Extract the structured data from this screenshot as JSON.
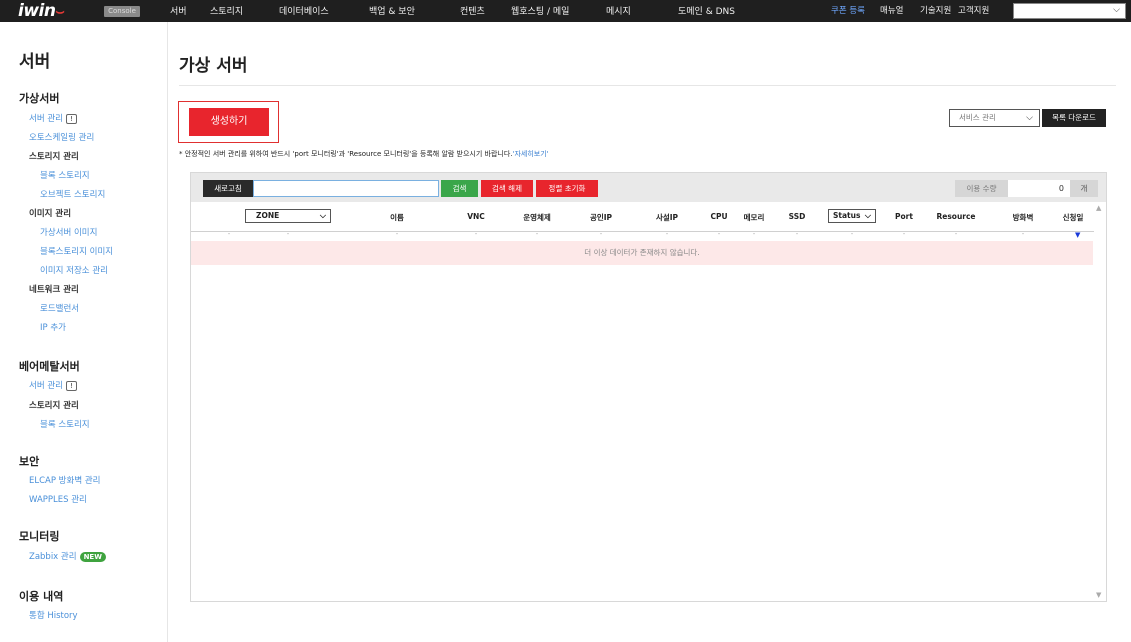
{
  "topbar": {
    "logo": "iwin",
    "console_badge": "Console",
    "nav": [
      "서버",
      "스토리지",
      "데이터베이스",
      "백업 & 보안",
      "컨텐츠",
      "웹호스팅 / 메일",
      "메시지",
      "도메인 & DNS"
    ],
    "right": {
      "coupon": "쿠폰 등록",
      "manual": "매뉴얼",
      "tech": "기술지원",
      "support": "고객지원"
    },
    "select_value": ""
  },
  "sidebar": {
    "title": "서버",
    "virtual": {
      "title": "가상서버",
      "server_mgmt": "서버 관리",
      "autoscaling": "오토스케일링 관리",
      "storage": "스토리지 관리",
      "block_storage": "블록 스토리지",
      "object_storage": "오브젝트 스토리지",
      "image": "이미지 관리",
      "vm_image": "가상서버 이미지",
      "block_image": "블록스토리지 이미지",
      "image_repo": "이미지 저장소 관리",
      "network": "네트워크 관리",
      "load_balancer": "로드밸런서",
      "ip_add": "IP 추가"
    },
    "bare": {
      "title": "베어메탈서버",
      "server_mgmt": "서버 관리",
      "storage": "스토리지 관리",
      "block_storage": "블록 스토리지"
    },
    "security": {
      "title": "보안",
      "elcap": "ELCAP 방화벽 관리",
      "wapples": "WAPPLES 관리"
    },
    "monitoring": {
      "title": "모니터링",
      "zabbix": "Zabbix 관리",
      "new_badge": "NEW"
    },
    "usage": {
      "title": "이용 내역",
      "history": "통합 History"
    },
    "info_icon": "!"
  },
  "main": {
    "title": "가상 서버",
    "create_button": "생성하기",
    "service_select": "서비스 관리",
    "download_button": "목록 다운로드",
    "notice": "* 안정적인 서버 관리를 위하여 반드시 'port 모니터링'과 'Resource 모니터링'을 등록해 알람 받으시기 바랍니다.",
    "notice_link": "'자세히보기'"
  },
  "toolbar": {
    "refresh": "새로고침",
    "search_value": "",
    "search": "검색",
    "clear_search": "검색 해제",
    "reset_sort": "정렬 초기화",
    "usage_label": "이용 수량",
    "usage_value": "0",
    "usage_unit": "개"
  },
  "table": {
    "zone": "ZONE",
    "name": "이름",
    "vnc": "VNC",
    "os": "운영체제",
    "public_ip": "공인IP",
    "private_ip": "사설IP",
    "cpu": "CPU",
    "memory": "메모리",
    "ssd": "SSD",
    "status": "Status",
    "port": "Port",
    "resource": "Resource",
    "firewall": "방화벽",
    "date": "신청일",
    "filter_placeholder": "-",
    "empty": "더 이상 데이터가 존재하지 않습니다."
  }
}
